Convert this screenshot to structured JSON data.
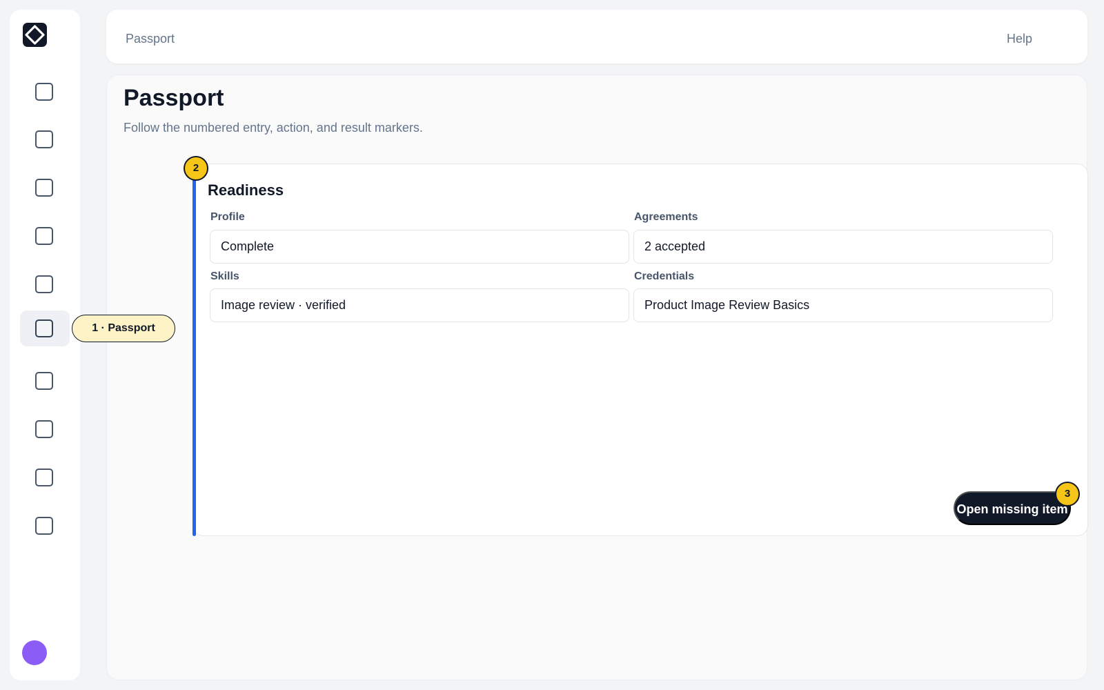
{
  "header": {
    "breadcrumb": "Passport",
    "help_label": "Help"
  },
  "page": {
    "title": "Passport",
    "subtitle": "Follow the numbered entry, action, and result markers."
  },
  "sidebar": {
    "items": [
      {
        "icon": "square-icon"
      },
      {
        "icon": "square-icon"
      },
      {
        "icon": "square-icon"
      },
      {
        "icon": "square-icon"
      },
      {
        "icon": "square-icon"
      },
      {
        "icon": "square-icon",
        "active": true
      },
      {
        "icon": "square-icon"
      },
      {
        "icon": "square-icon"
      },
      {
        "icon": "square-icon"
      },
      {
        "icon": "square-icon"
      }
    ],
    "active_index": 5
  },
  "markers": {
    "entry_label": "1 · Passport",
    "step2": "2",
    "step3": "3"
  },
  "readiness": {
    "title": "Readiness",
    "fields": [
      {
        "label": "Profile",
        "value": "Complete"
      },
      {
        "label": "Agreements",
        "value": "2 accepted"
      },
      {
        "label": "Skills",
        "value": "Image review · verified"
      },
      {
        "label": "Credentials",
        "value": "Product Image Review Basics"
      }
    ]
  },
  "action": {
    "label": "Open missing item"
  },
  "colors": {
    "accent": "#2563eb",
    "marker": "#f5c518",
    "entry_pill": "#fef3c7",
    "dark": "#111827",
    "avatar": "#8b5cf6"
  }
}
